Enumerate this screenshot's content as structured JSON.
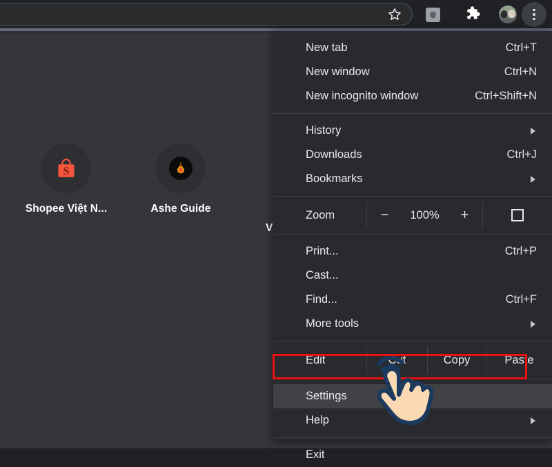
{
  "browser": {
    "toolbar": {
      "omnibox_value": "",
      "omnibox_placeholder": "",
      "star_icon": "star-icon",
      "shield_icon": "shield-icon",
      "extensions_icon": "puzzle-piece-icon",
      "profile_icon": "avatar",
      "menu_icon": "three-dot-menu-icon"
    }
  },
  "newtab": {
    "shortcuts": [
      {
        "label": "Shopee Việt N...",
        "icon": "shopee-bag-icon"
      },
      {
        "label": "Ashe Guide",
        "icon": "flame-badge-icon"
      },
      {
        "label": "V",
        "icon": "partial-icon"
      }
    ]
  },
  "menu": {
    "groups": [
      {
        "items": [
          {
            "label": "New tab",
            "accel": "Ctrl+T",
            "arrow": false
          },
          {
            "label": "New window",
            "accel": "Ctrl+N",
            "arrow": false
          },
          {
            "label": "New incognito window",
            "accel": "Ctrl+Shift+N",
            "arrow": false
          }
        ]
      },
      {
        "items": [
          {
            "label": "History",
            "accel": "",
            "arrow": true
          },
          {
            "label": "Downloads",
            "accel": "Ctrl+J",
            "arrow": false
          },
          {
            "label": "Bookmarks",
            "accel": "",
            "arrow": true
          }
        ]
      }
    ],
    "zoom": {
      "label": "Zoom",
      "minus": "−",
      "percent": "100%",
      "plus": "+",
      "fullscreen_icon": "fullscreen-icon"
    },
    "tools": {
      "items": [
        {
          "label": "Print...",
          "accel": "Ctrl+P",
          "arrow": false
        },
        {
          "label": "Cast...",
          "accel": "",
          "arrow": false
        },
        {
          "label": "Find...",
          "accel": "Ctrl+F",
          "arrow": false
        },
        {
          "label": "More tools",
          "accel": "",
          "arrow": true
        }
      ]
    },
    "edit": {
      "label": "Edit",
      "cut": "Cut",
      "copy": "Copy",
      "paste": "Paste"
    },
    "settings": {
      "label": "Settings"
    },
    "help": {
      "label": "Help"
    },
    "exit": {
      "label": "Exit"
    }
  },
  "annotation": {
    "highlight_color": "#ee1111",
    "cursor": "pointing-hand-cursor",
    "target_item": "Settings"
  }
}
